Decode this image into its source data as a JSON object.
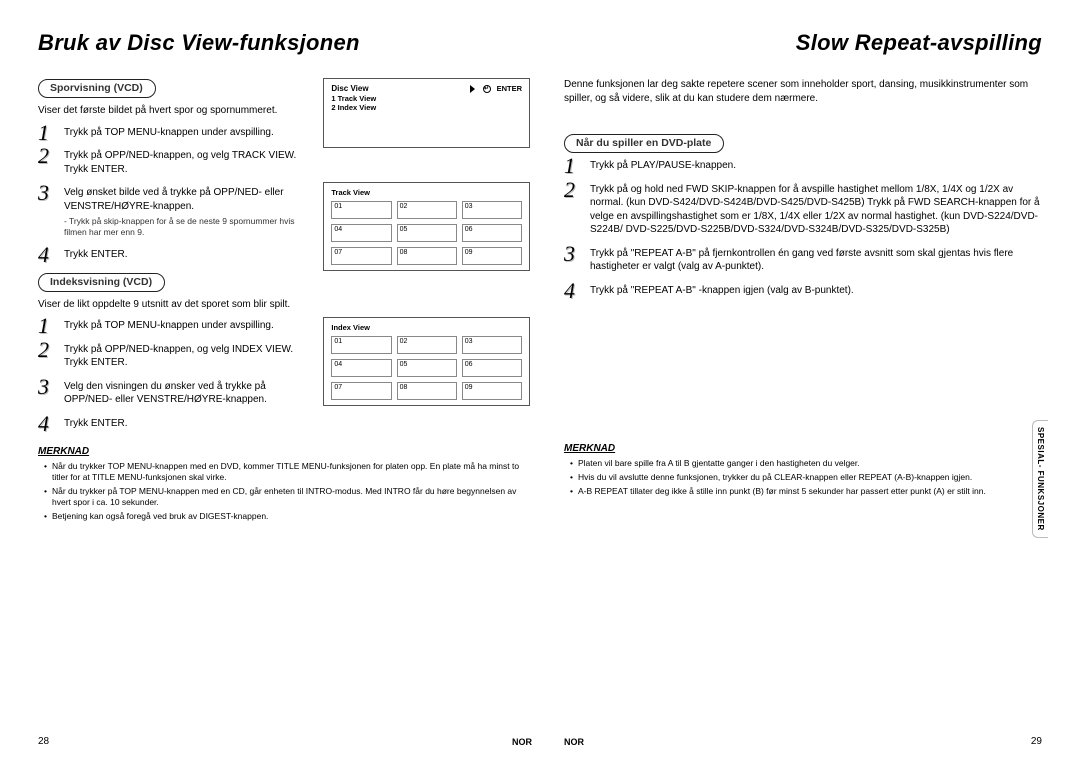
{
  "left": {
    "title": "Bruk av Disc View-funksjonen",
    "section1": {
      "pill": "Sporvisning (VCD)",
      "lead": "Viser det første bildet på hvert spor og spornummeret.",
      "steps": [
        {
          "n": "1",
          "t": "Trykk på TOP MENU-knappen under avspilling."
        },
        {
          "n": "2",
          "t": "Trykk på OPP/NED-knappen, og velg TRACK VIEW. Trykk ENTER."
        },
        {
          "n": "3",
          "t": "Velg ønsket bilde ved å trykke på OPP/NED- eller VENSTRE/HØYRE-knappen.",
          "sub": "- Trykk på skip-knappen for å se de neste 9 spornummer hvis filmen har mer enn 9."
        },
        {
          "n": "4",
          "t": "Trykk ENTER."
        }
      ]
    },
    "section2": {
      "pill": "Indeksvisning (VCD)",
      "lead": "Viser de likt oppdelte 9 utsnitt av det sporet som blir spilt.",
      "steps": [
        {
          "n": "1",
          "t": "Trykk på TOP MENU-knappen under avspilling."
        },
        {
          "n": "2",
          "t": "Trykk på OPP/NED-knappen, og velg INDEX VIEW. Trykk ENTER."
        },
        {
          "n": "3",
          "t": "Velg den visningen du ønsker ved å trykke på OPP/NED- eller VENSTRE/HØYRE-knappen."
        },
        {
          "n": "4",
          "t": "Trykk ENTER."
        }
      ]
    },
    "screen1": {
      "title": "Disc View",
      "enter": "ENTER",
      "row1": "1  Track  View",
      "row2": "2  Index  View"
    },
    "thumb1": {
      "title": "Track View",
      "cells": [
        "01",
        "02",
        "03",
        "04",
        "05",
        "06",
        "07",
        "08",
        "09"
      ]
    },
    "thumb2": {
      "title": "Index View",
      "cells": [
        "01",
        "02",
        "03",
        "04",
        "05",
        "06",
        "07",
        "08",
        "09"
      ]
    },
    "noteHdr": "MERKNAD",
    "notes": [
      "Når du trykker TOP MENU-knappen med en DVD, kommer TITLE MENU-funksjonen for platen opp. En plate må ha minst to titler for at TITLE MENU-funksjonen skal virke.",
      "Når du trykker på TOP MENU-knappen med en CD, går enheten til INTRO-modus. Med INTRO får du høre begynnelsen av hvert spor i ca. 10 sekunder.",
      "Betjening kan også foregå ved bruk av DIGEST-knappen."
    ],
    "pageNum": "28",
    "lang": "NOR"
  },
  "right": {
    "title": "Slow Repeat-avspilling",
    "intro": "Denne funksjonen lar deg sakte repetere scener som inneholder sport, dansing, musikkinstrumenter som spiller, og så videre, slik at du kan studere dem nærmere.",
    "sectionPill": "Når du spiller en DVD-plate",
    "steps": [
      {
        "n": "1",
        "t": "Trykk på PLAY/PAUSE-knappen."
      },
      {
        "n": "2",
        "t": "Trykk på og hold ned FWD SKIP-knappen for å avspille hastighet mellom 1/8X, 1/4X og 1/2X av normal. (kun DVD-S424/DVD-S424B/DVD-S425/DVD-S425B) Trykk på FWD SEARCH-knappen for å velge en avspillingshastighet som er 1/8X, 1/4X eller 1/2X av normal hastighet. (kun DVD-S224/DVD-S224B/ DVD-S225/DVD-S225B/DVD-S324/DVD-S324B/DVD-S325/DVD-S325B)"
      },
      {
        "n": "3",
        "t": "Trykk på \"REPEAT A-B\" på fjernkontrollen én gang ved første avsnitt som skal gjentas hvis flere hastigheter er valgt (valg av A-punktet)."
      },
      {
        "n": "4",
        "t": "Trykk på \"REPEAT A-B\" -knappen igjen (valg av B-punktet)."
      }
    ],
    "noteHdr": "MERKNAD",
    "notes": [
      "Platen vil bare spille fra A til B gjentatte ganger i den hastigheten du velger.",
      "Hvis du vil avslutte denne funksjonen, trykker du på CLEAR-knappen eller REPEAT (A-B)-knappen igjen.",
      "A-B REPEAT tillater deg ikke å stille inn punkt (B) før minst 5 sekunder har passert etter punkt (A) er stilt inn."
    ],
    "sideTab": "SPESIAL-\nFUNKSJONER",
    "pageNum": "29",
    "lang": "NOR"
  }
}
